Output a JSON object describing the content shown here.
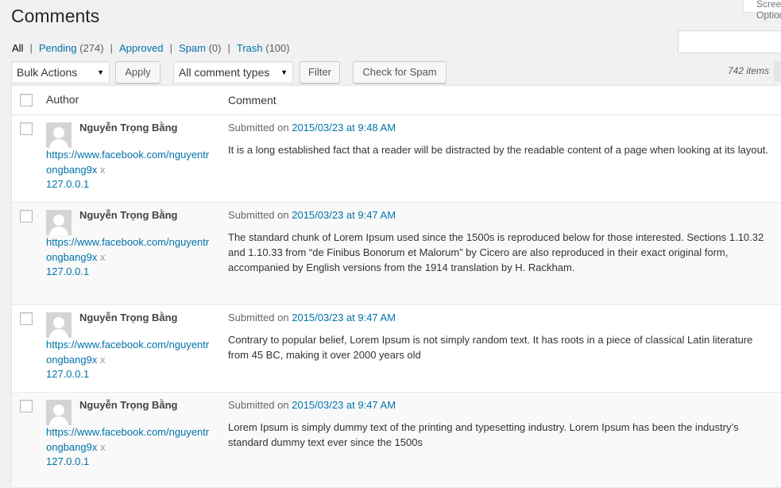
{
  "page": {
    "title": "Comments",
    "screen_options": "Screen Options"
  },
  "filters": [
    {
      "label": "All",
      "count": "",
      "current": true
    },
    {
      "label": "Pending",
      "count": "(274)"
    },
    {
      "label": "Approved",
      "count": ""
    },
    {
      "label": "Spam",
      "count": "(0)"
    },
    {
      "label": "Trash",
      "count": "(100)"
    }
  ],
  "toolbar": {
    "bulk_actions": "Bulk Actions",
    "apply": "Apply",
    "comment_type": "All comment types",
    "filter": "Filter",
    "check_spam": "Check for Spam",
    "items": "742 items"
  },
  "table": {
    "col_author": "Author",
    "col_comment": "Comment",
    "rows": [
      {
        "author": "Nguyễn Trọng Bằng",
        "url": "https://www.facebook.com/nguyentrongbang9x",
        "x": "x",
        "ip": "127.0.0.1",
        "submitted_prefix": "Submitted on",
        "date": "2015/03/23 at 9:48 AM",
        "text": "It is a long established fact that a reader will be distracted by the readable content of a page when looking at its layout."
      },
      {
        "author": "Nguyễn Trọng Bằng",
        "url": "https://www.facebook.com/nguyentrongbang9x",
        "x": "x",
        "ip": "127.0.0.1",
        "submitted_prefix": "Submitted on",
        "date": "2015/03/23 at 9:47 AM",
        "text": "The standard chunk of Lorem Ipsum used since the 1500s is reproduced below for those interested. Sections 1.10.32 and 1.10.33 from “de Finibus Bonorum et Malorum” by Cicero are also reproduced in their exact original form, accompanied by English versions from the 1914 translation by H. Rackham."
      },
      {
        "author": "Nguyễn Trọng Bằng",
        "url": "https://www.facebook.com/nguyentrongbang9x",
        "x": "x",
        "ip": "127.0.0.1",
        "submitted_prefix": "Submitted on",
        "date": "2015/03/23 at 9:47 AM",
        "text": "Contrary to popular belief, Lorem Ipsum is not simply random text. It has roots in a piece of classical Latin literature from 45 BC, making it over 2000 years old"
      },
      {
        "author": "Nguyễn Trọng Bằng",
        "url": "https://www.facebook.com/nguyentrongbang9x",
        "x": "x",
        "ip": "127.0.0.1",
        "submitted_prefix": "Submitted on",
        "date": "2015/03/23 at 9:47 AM",
        "text": "Lorem Ipsum is simply dummy text of the printing and typesetting industry. Lorem Ipsum has been the industry’s standard dummy text ever since the 1500s"
      }
    ]
  },
  "colors": {
    "link": "#0073aa",
    "background": "#f1f1f1",
    "alt_row": "#f9f9f9"
  }
}
